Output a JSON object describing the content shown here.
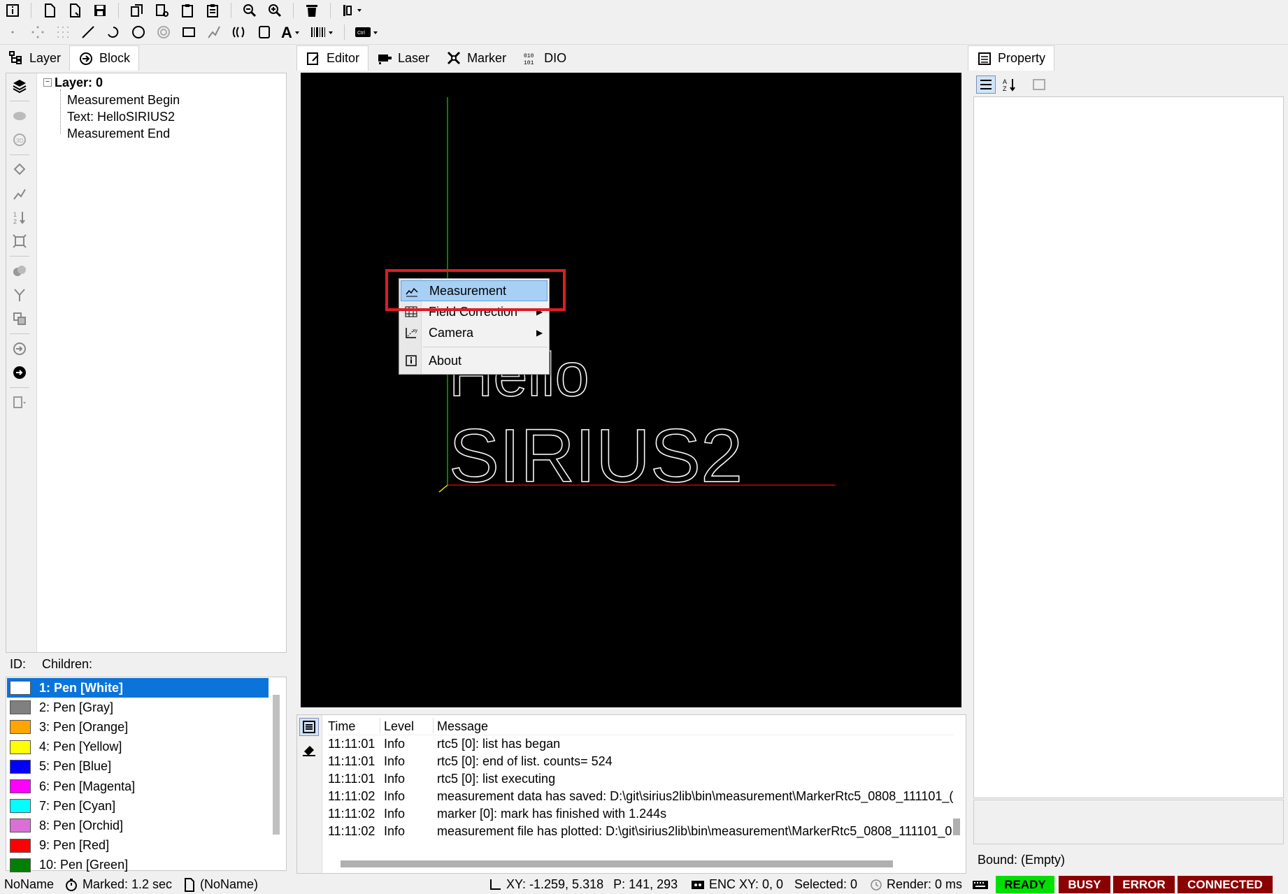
{
  "toolbar_top": {
    "icons": [
      "info-icon",
      "new-file-icon",
      "new-document-icon",
      "save-icon",
      "copy-icon",
      "cut-icon",
      "paste-icon",
      "paste-array-icon",
      "zoom-out-icon",
      "zoom-in-icon",
      "delete-icon",
      "align-icon"
    ]
  },
  "toolbar_draw": {
    "icons": [
      "point-icon",
      "points-icon",
      "line-icon",
      "arc-icon",
      "circle-icon",
      "spiral-icon",
      "rectangle-icon",
      "lwpolyline-icon",
      "trepan-icon",
      "image-icon",
      "text-icon",
      "barcode-icon",
      "ctrl-icon"
    ],
    "ctrl_label": "Ctrl"
  },
  "left_tabs": [
    {
      "label": "Layer"
    },
    {
      "label": "Block"
    }
  ],
  "center_tabs": [
    {
      "label": "Editor"
    },
    {
      "label": "Laser"
    },
    {
      "label": "Marker"
    },
    {
      "label": "DIO"
    }
  ],
  "right_tabs": [
    {
      "label": "Property"
    }
  ],
  "tree": {
    "root": "Layer: 0",
    "items": [
      "Measurement Begin",
      "Text: HelloSIRIUS2",
      "Measurement End"
    ]
  },
  "info_bar": {
    "id_label": "ID:",
    "children_label": "Children:"
  },
  "pens": [
    {
      "label": "1: Pen [White]",
      "color": "#ffffff"
    },
    {
      "label": "2: Pen [Gray]",
      "color": "#808080"
    },
    {
      "label": "3: Pen [Orange]",
      "color": "#ffa500"
    },
    {
      "label": "4: Pen [Yellow]",
      "color": "#ffff00"
    },
    {
      "label": "5: Pen [Blue]",
      "color": "#0000ff"
    },
    {
      "label": "6: Pen [Magenta]",
      "color": "#ff00ff"
    },
    {
      "label": "7: Pen [Cyan]",
      "color": "#00ffff"
    },
    {
      "label": "8: Pen [Orchid]",
      "color": "#da70d6"
    },
    {
      "label": "9: Pen [Red]",
      "color": "#ff0000"
    },
    {
      "label": "10: Pen [Green]",
      "color": "#008000"
    }
  ],
  "canvas": {
    "text_line1": "Hello",
    "text_line2": "SIRIUS2"
  },
  "context_menu": {
    "items": [
      {
        "label": "Measurement",
        "icon": "chart-icon"
      },
      {
        "label": "Field Correction",
        "icon": "grid-icon"
      },
      {
        "label": "Camera",
        "icon": "camera-calibration-icon"
      },
      {
        "label": "About",
        "icon": "info-icon"
      }
    ]
  },
  "log": {
    "headers": [
      "Time",
      "Level",
      "Message"
    ],
    "rows": [
      {
        "time": "11:11:01",
        "level": "Info",
        "message": "rtc5 [0]: list has began"
      },
      {
        "time": "11:11:01",
        "level": "Info",
        "message": "rtc5 [0]: end of list. counts= 524"
      },
      {
        "time": "11:11:01",
        "level": "Info",
        "message": "rtc5 [0]: list executing"
      },
      {
        "time": "11:11:02",
        "level": "Info",
        "message": "measurement data has saved: D:\\git\\sirius2lib\\bin\\measurement\\MarkerRtc5_0808_111101_("
      },
      {
        "time": "11:11:02",
        "level": "Info",
        "message": "marker [0]: mark has finished with 1.244s"
      },
      {
        "time": "11:11:02",
        "level": "Info",
        "message": "measurement file has plotted: D:\\git\\sirius2lib\\bin\\measurement\\MarkerRtc5_0808_111101_0"
      }
    ]
  },
  "property": {
    "bound": "Bound: (Empty)"
  },
  "status": {
    "name": "NoName",
    "marked": "Marked: 1.2 sec",
    "doc": "(NoName)",
    "xy": "XY: -1.259, 5.318",
    "p": "P: 141, 293",
    "enc": "ENC XY: 0, 0",
    "selected": "Selected: 0",
    "render": "Render: 0 ms",
    "ready": "READY",
    "busy": "BUSY",
    "error": "ERROR",
    "connected": "CONNECTED",
    "ready_color": "#00e000",
    "busy_color": "#8b0000",
    "error_color": "#8b0000",
    "connected_color": "#8b0000"
  }
}
